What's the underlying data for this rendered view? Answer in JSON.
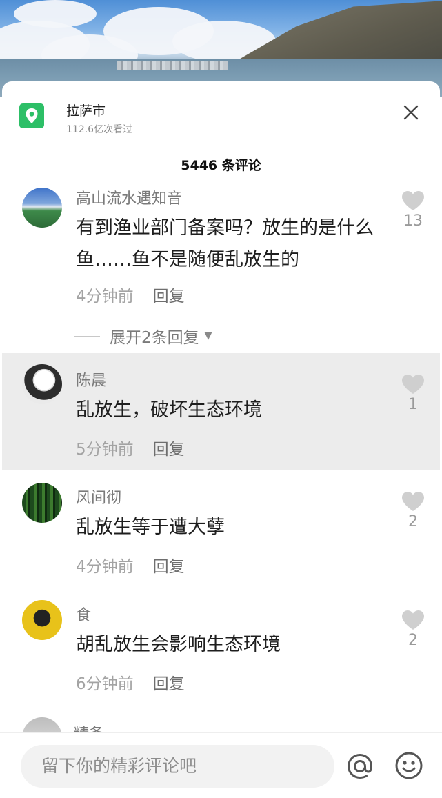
{
  "location": {
    "title": "拉萨市",
    "views": "112.6亿次看过"
  },
  "comments_header": "5446 条评论",
  "comments": [
    {
      "name": "高山流水遇知音",
      "text": "有到渔业部门备案吗？放生的是什么鱼……鱼不是随便乱放生的",
      "time": "4分钟前",
      "reply": "回复",
      "likes": "13"
    },
    {
      "name": "陈晨",
      "text": "乱放生，破坏生态环境",
      "time": "5分钟前",
      "reply": "回复",
      "likes": "1"
    },
    {
      "name": "风间彻",
      "text": "乱放生等于遭大孽",
      "time": "4分钟前",
      "reply": "回复",
      "likes": "2"
    },
    {
      "name": "食",
      "text": "胡乱放生会影响生态环境",
      "time": "6分钟前",
      "reply": "回复",
      "likes": "2"
    }
  ],
  "expand_replies": "展开2条回复",
  "partial_comment_name": "精备",
  "comment_input": {
    "placeholder": "留下你的精彩评论吧"
  },
  "colors": {
    "location_green": "#2dbf67",
    "highlight_bg": "#ececec",
    "like_gray": "#cfcfcf"
  },
  "icons": [
    "location-pin-icon",
    "close-icon",
    "heart-icon",
    "at-icon",
    "emoji-icon"
  ]
}
